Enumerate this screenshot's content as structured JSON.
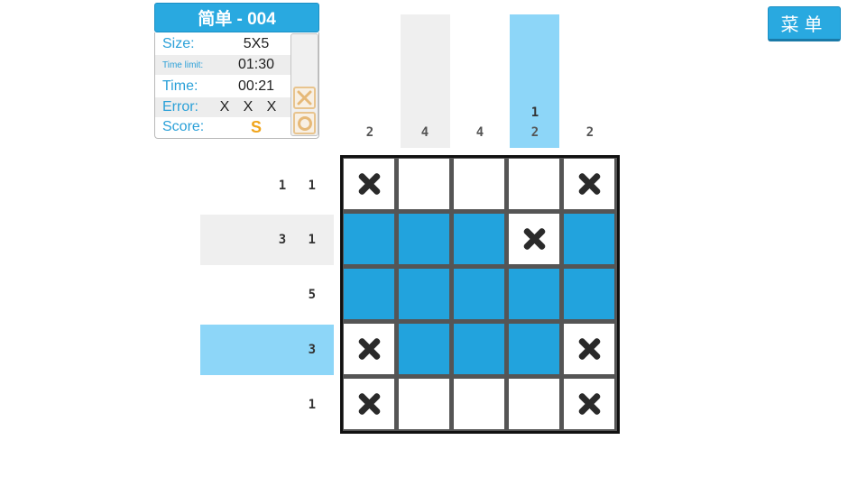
{
  "header": {
    "title": "简单 - 004"
  },
  "stats": {
    "size_label": "Size:",
    "size_value": "5X5",
    "time_limit_label": "Time limit:",
    "time_limit_value": "01:30",
    "time_label": "Time:",
    "time_value": "00:21",
    "error_label": "Error:",
    "errors": [
      "X",
      "X",
      "X"
    ],
    "score_label": "Score:",
    "score_value": "S"
  },
  "tools": {
    "cross_icon": "cross-mark-tool-icon",
    "circle_icon": "circle-tool-icon"
  },
  "menu": {
    "label": "菜单"
  },
  "column_clues": [
    [
      "2"
    ],
    [
      "4"
    ],
    [
      "4"
    ],
    [
      "1",
      "2"
    ],
    [
      "2"
    ]
  ],
  "row_clues": [
    "1 1",
    "3 1",
    "5",
    "3",
    "1"
  ],
  "highlight": {
    "column": 4,
    "row": 4,
    "gray_column": 2,
    "gray_row": 2
  },
  "grid": [
    [
      "x",
      "e",
      "e",
      "e",
      "x"
    ],
    [
      "f",
      "f",
      "f",
      "x",
      "f"
    ],
    [
      "f",
      "f",
      "f",
      "f",
      "f"
    ],
    [
      "x",
      "f",
      "f",
      "f",
      "x"
    ],
    [
      "x",
      "e",
      "e",
      "e",
      "x"
    ]
  ],
  "colors": {
    "accent": "#29a9e0",
    "filled": "#22a3dd",
    "highlight_blue": "#8dd6f8",
    "highlight_gray": "#efefef",
    "score": "#f0a51c"
  }
}
